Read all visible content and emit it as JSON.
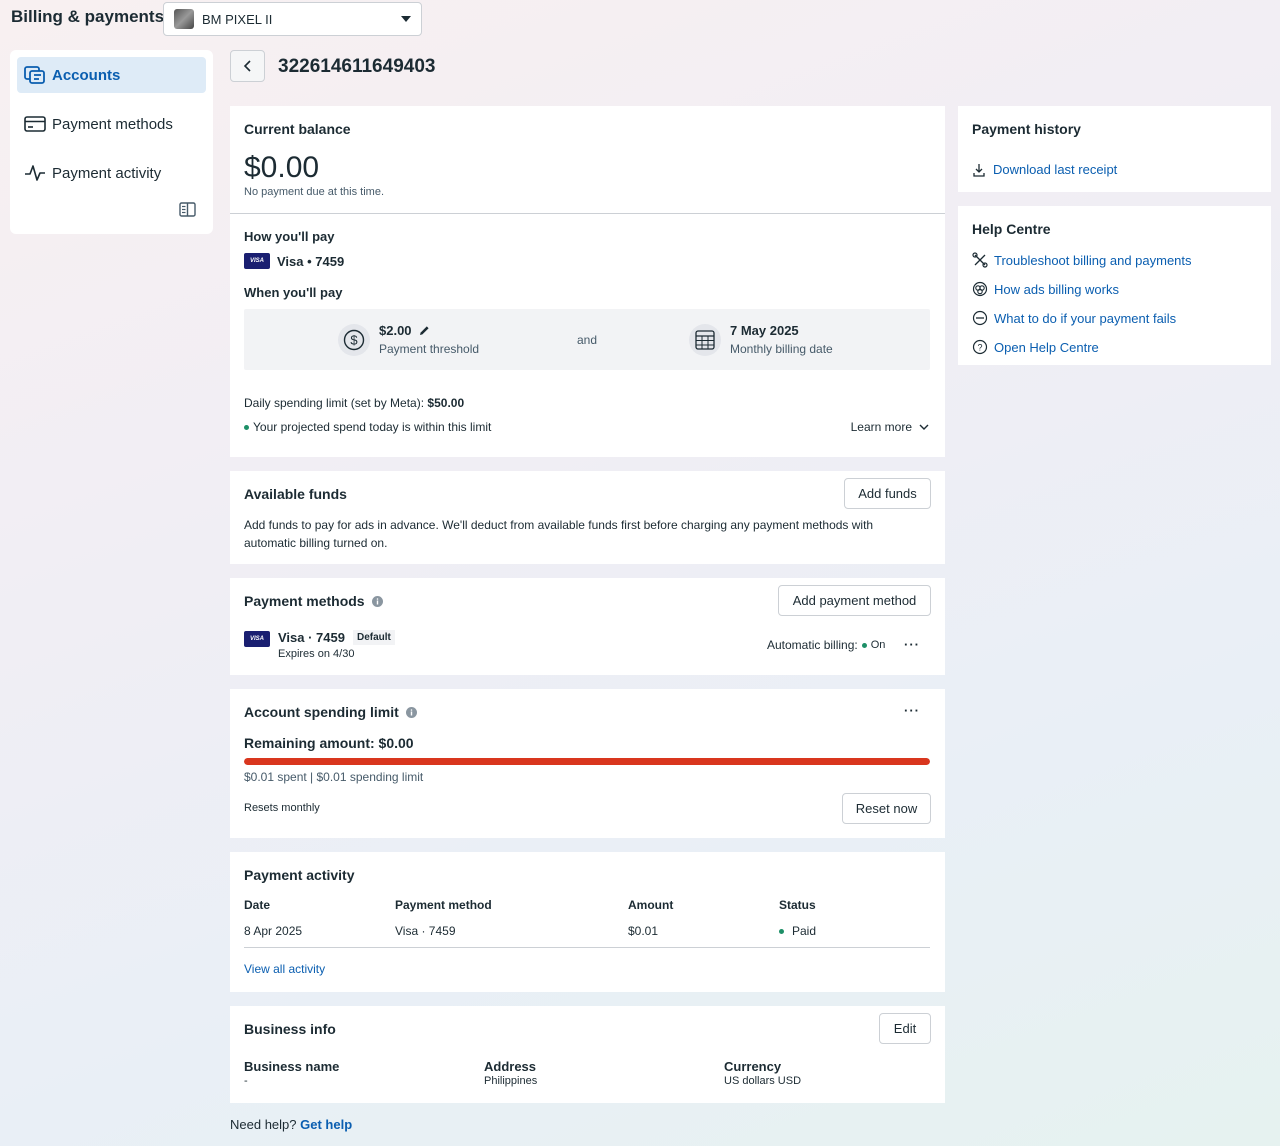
{
  "header": {
    "title": "Billing & payments",
    "account_name": "BM PIXEL II"
  },
  "sidebar": {
    "items": [
      {
        "label": "Accounts",
        "icon": "accounts-icon",
        "active": true
      },
      {
        "label": "Payment methods",
        "icon": "credit-card-icon",
        "active": false
      },
      {
        "label": "Payment activity",
        "icon": "activity-icon",
        "active": false
      }
    ]
  },
  "account": {
    "id": "322614611649403"
  },
  "balance": {
    "title": "Current balance",
    "amount": "$0.00",
    "note": "No payment due at this time.",
    "how_title": "How you'll pay",
    "card_label": "Visa • 7459",
    "when_title": "When you'll pay",
    "threshold_amount": "$2.00",
    "threshold_label": "Payment threshold",
    "and_label": "and",
    "billing_date": "7 May 2025",
    "billing_date_label": "Monthly billing date",
    "daily_limit_prefix": "Daily spending limit (set by Meta):",
    "daily_limit_value": "$50.00",
    "projected_note": "Your projected spend today is within this limit",
    "learn_more": "Learn more"
  },
  "funds": {
    "title": "Available funds",
    "button": "Add funds",
    "description": "Add funds to pay for ads in advance. We'll deduct from available funds first before charging any payment methods with automatic billing turned on."
  },
  "payment_methods": {
    "title": "Payment methods",
    "button": "Add payment method",
    "card_label": "Visa · 7459",
    "default_badge": "Default",
    "expires": "Expires on 4/30",
    "auto_billing_label": "Automatic billing:",
    "auto_billing_value": "On",
    "more": "···"
  },
  "spending_limit": {
    "title": "Account spending limit",
    "remaining": "Remaining amount: $0.00",
    "usage": "$0.01 spent | $0.01 spending limit",
    "progress_fraction": 1.0,
    "bar_color": "#d9361e",
    "resets": "Resets monthly",
    "button": "Reset now",
    "more": "···"
  },
  "activity": {
    "title": "Payment activity",
    "columns": [
      "Date",
      "Payment method",
      "Amount",
      "Status"
    ],
    "rows": [
      {
        "date": "8 Apr 2025",
        "method": "Visa · 7459",
        "amount": "$0.01",
        "status": "Paid"
      }
    ],
    "view_all": "View all activity"
  },
  "business": {
    "title": "Business info",
    "button": "Edit",
    "name_label": "Business name",
    "name_value": "-",
    "address_label": "Address",
    "address_value": "Philippines",
    "currency_label": "Currency",
    "currency_value": "US dollars USD"
  },
  "footer": {
    "need_help": "Need help?",
    "get_help": "Get help"
  },
  "history": {
    "title": "Payment history",
    "download": "Download last receipt"
  },
  "help_centre": {
    "title": "Help Centre",
    "links": [
      {
        "label": "Troubleshoot billing and payments",
        "icon": "wrench-icon"
      },
      {
        "label": "How ads billing works",
        "icon": "billing-gear-icon"
      },
      {
        "label": "What to do if your payment fails",
        "icon": "minus-circle-icon"
      },
      {
        "label": "Open Help Centre",
        "icon": "question-circle-icon"
      }
    ]
  },
  "colors": {
    "accent": "#0a5eb0",
    "active_bg": "#deebf7",
    "success": "#1d8f67",
    "danger": "#d9361e"
  }
}
